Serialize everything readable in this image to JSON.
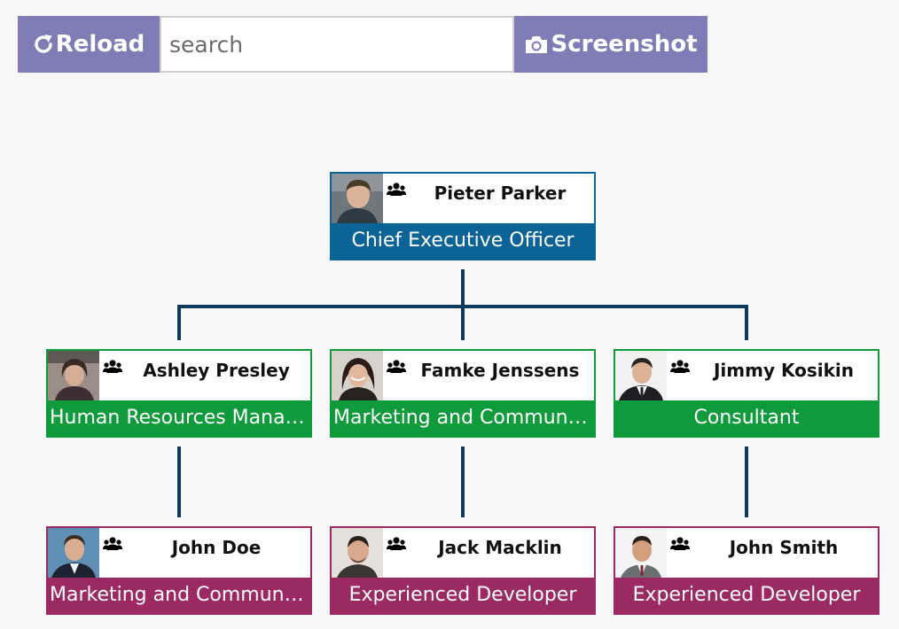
{
  "toolbar": {
    "reload_label": "Reload",
    "search_placeholder": "search",
    "search_value": "",
    "screenshot_label": "Screenshot",
    "button_color": "#7f7db5"
  },
  "colors": {
    "executive": "#0b6396",
    "manager": "#0f9a3b",
    "developer": "#9b2a62",
    "connector": "#0d3a5c"
  },
  "org": {
    "ceo": {
      "name": "Pieter Parker",
      "title": "Chief Executive Officer"
    },
    "managers": [
      {
        "name": "Ashley Presley",
        "title": "Human Resources Manager"
      },
      {
        "name": "Famke Jenssens",
        "title": "Marketing and Community Manager"
      },
      {
        "name": "Jimmy Kosikin",
        "title": "Consultant"
      }
    ],
    "staff": [
      {
        "name": "John Doe",
        "title": "Marketing and Community Manager"
      },
      {
        "name": "Jack Macklin",
        "title": "Experienced Developer"
      },
      {
        "name": "John Smith",
        "title": "Experienced Developer"
      }
    ]
  }
}
